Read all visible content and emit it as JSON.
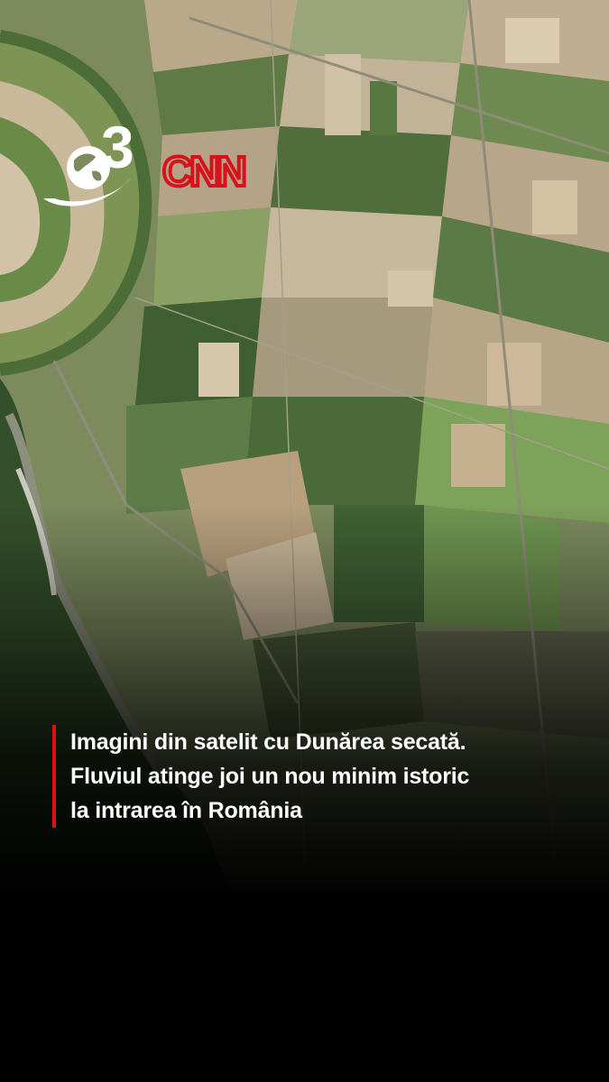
{
  "logo": {
    "channel_number": "3",
    "brand": "CNN",
    "brand_color": "#d8121c"
  },
  "caption": {
    "accent_color": "#e01010",
    "lines": [
      "Imagini din satelit cu Dunărea secată.",
      "Fluviul atinge joi un nou minim istoric",
      "la intrarea în România"
    ]
  },
  "scene": {
    "type": "satellite-image",
    "subject": "farmland-fields-dry-riverbed"
  }
}
